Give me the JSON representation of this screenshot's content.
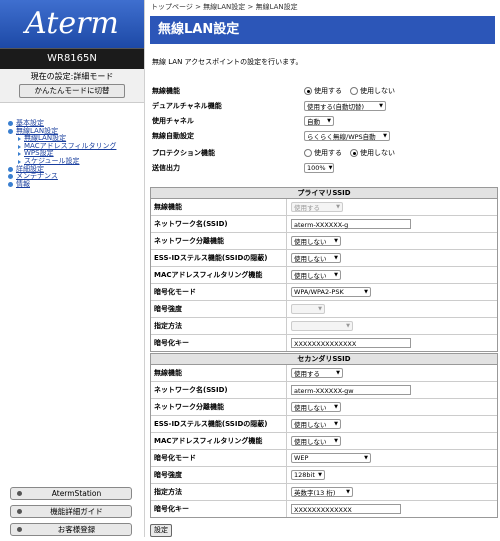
{
  "sidebar": {
    "logo_text": "Aterm",
    "model": "WR8165N",
    "mode_text": "現在の設定:詳細モード",
    "mode_button": "かんたんモードに切替",
    "nav": [
      {
        "label": "基本設定",
        "level": 0
      },
      {
        "label": "無線LAN設定",
        "level": 0
      },
      {
        "label": "無線LAN設定",
        "level": 1
      },
      {
        "label": "MACアドレスフィルタリング",
        "level": 1
      },
      {
        "label": "WPS設定",
        "level": 1
      },
      {
        "label": "スケジュール設定",
        "level": 1
      },
      {
        "label": "詳細設定",
        "level": 0
      },
      {
        "label": "メンテナンス",
        "level": 0
      },
      {
        "label": "情報",
        "level": 0
      }
    ],
    "buttons": [
      "AtermStation",
      "機能詳細ガイド",
      "お客様登録"
    ]
  },
  "breadcrumb": "トップページ > 無線LAN設定 > 無線LAN設定",
  "title": "無線LAN設定",
  "description": "無線 LAN アクセスポイントの設定を行います。",
  "general": {
    "wireless": {
      "label": "無線機能",
      "opt1": "使用する",
      "opt2": "使用しない",
      "selected": 1
    },
    "dual": {
      "label": "デュアルチャネル機能",
      "value": "使用する(自動切替)"
    },
    "channel": {
      "label": "使用チャネル",
      "value": "自動"
    },
    "auto_set": {
      "label": "無線自動設定",
      "value": "らくらく無線/WPS自動"
    },
    "protection": {
      "label": "プロテクション機能",
      "opt1": "使用する",
      "opt2": "使用しない",
      "selected": 2
    },
    "power": {
      "label": "送信出力",
      "value": "100%"
    }
  },
  "primary": {
    "header": "プライマリSSID",
    "rows": {
      "wireless": {
        "label": "無線機能",
        "value": "使用する"
      },
      "ssid": {
        "label": "ネットワーク名(SSID)",
        "value": "aterm-XXXXXX-g"
      },
      "sep": {
        "label": "ネットワーク分離機能",
        "value": "使用しない"
      },
      "stealth": {
        "label": "ESS-IDステルス機能(SSIDの隠蔽)",
        "value": "使用しない"
      },
      "mac": {
        "label": "MACアドレスフィルタリング機能",
        "value": "使用しない"
      },
      "enc_mode": {
        "label": "暗号化モード",
        "value": "WPA/WPA2-PSK"
      },
      "enc_strength": {
        "label": "暗号強度",
        "value": ""
      },
      "method": {
        "label": "指定方法",
        "value": ""
      },
      "key": {
        "label": "暗号化キー",
        "value": "XXXXXXXXXXXXXX"
      }
    }
  },
  "secondary": {
    "header": "セカンダリSSID",
    "rows": {
      "wireless": {
        "label": "無線機能",
        "value": "使用する"
      },
      "ssid": {
        "label": "ネットワーク名(SSID)",
        "value": "aterm-XXXXXX-gw"
      },
      "sep": {
        "label": "ネットワーク分離機能",
        "value": "使用しない"
      },
      "stealth": {
        "label": "ESS-IDステルス機能(SSIDの隠蔽)",
        "value": "使用しない"
      },
      "mac": {
        "label": "MACアドレスフィルタリング機能",
        "value": "使用しない"
      },
      "enc_mode": {
        "label": "暗号化モード",
        "value": "WEP"
      },
      "enc_strength": {
        "label": "暗号強度",
        "value": "128bit"
      },
      "method": {
        "label": "指定方法",
        "value": "英数字(13 桁)"
      },
      "key": {
        "label": "暗号化キー",
        "value": "XXXXXXXXXXXXX"
      }
    }
  },
  "submit_label": "設定",
  "colors": {
    "title_bg": "#2c56b8",
    "nav_link": "#1a3f9e"
  }
}
